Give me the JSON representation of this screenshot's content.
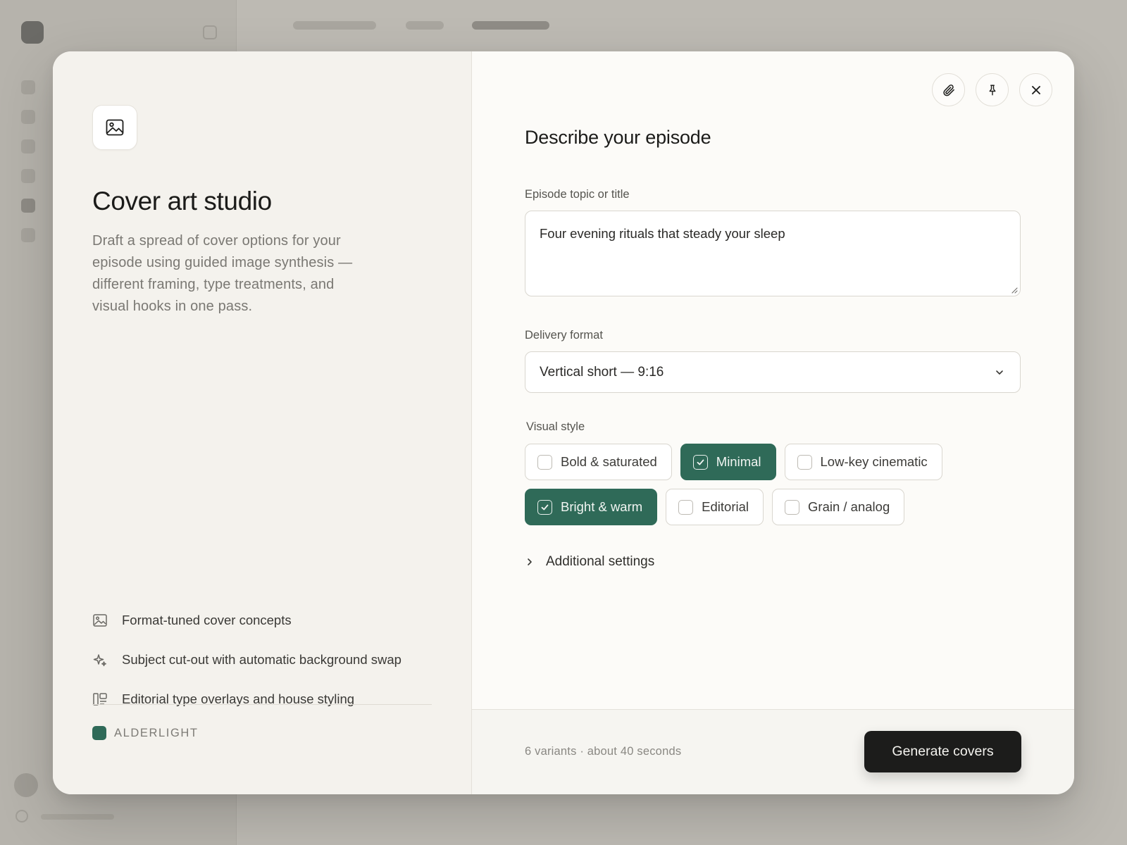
{
  "modal": {
    "title": "Cover art studio",
    "subtitle": "Draft a spread of cover options for your episode using guided image synthesis — different framing, type treatments, and visual hooks in one pass.",
    "features": [
      {
        "icon": "image-icon",
        "label": "Format-tuned cover concepts"
      },
      {
        "icon": "sparkle-icon",
        "label": "Subject cut-out with automatic background swap"
      },
      {
        "icon": "layout-icon",
        "label": "Editorial type overlays and house styling"
      }
    ],
    "brand": {
      "name": "ALDERLIGHT",
      "color": "#2f6a58"
    }
  },
  "actions": {
    "attach_icon": "paperclip-icon",
    "pin_icon": "pin-icon",
    "close_icon": "close-icon"
  },
  "form": {
    "heading": "Describe your episode",
    "topic": {
      "label": "Episode topic or title",
      "value": "Four evening rituals that steady your sleep"
    },
    "format": {
      "label": "Delivery format",
      "value": "Vertical short — 9:16"
    },
    "style": {
      "label": "Visual style",
      "options": [
        {
          "label": "Bold & saturated",
          "selected": false
        },
        {
          "label": "Minimal",
          "selected": true
        },
        {
          "label": "Low-key cinematic",
          "selected": false
        },
        {
          "label": "Bright & warm",
          "selected": true
        },
        {
          "label": "Editorial",
          "selected": false
        },
        {
          "label": "Grain / analog",
          "selected": false
        }
      ]
    },
    "additional_settings": "Additional settings"
  },
  "footer": {
    "info": "6 variants · about 40 seconds",
    "generate_label": "Generate covers"
  },
  "colors": {
    "accent": "#2f6a58",
    "primary_button": "#1c1c1b"
  }
}
